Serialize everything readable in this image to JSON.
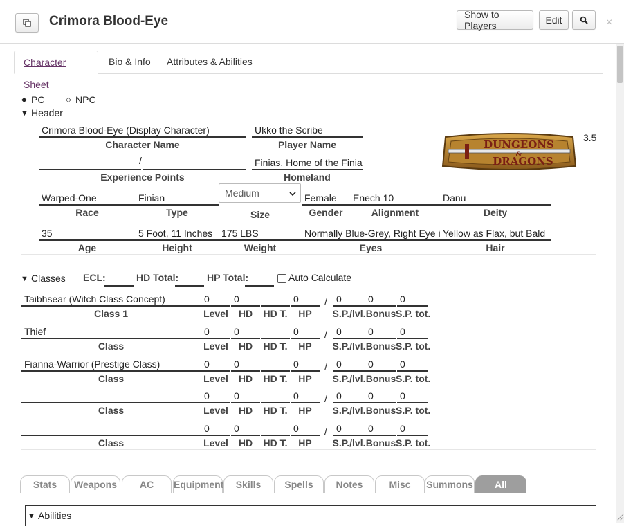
{
  "window": {
    "title": "Crimora Blood-Eye",
    "buttons": {
      "show_to_players": "Show to Players",
      "edit": "Edit"
    },
    "close_glyph": "×"
  },
  "tabs": [
    "Character Sheet",
    "Bio & Info",
    "Attributes & Abilities"
  ],
  "toggle": {
    "pc": "PC",
    "npc": "NPC"
  },
  "header": {
    "section_label": "Header",
    "character_name": "Crimora Blood-Eye    (Display Character)",
    "character_name_label": "Character Name",
    "player_name": "Ukko the Scribe",
    "player_name_label": "Player Name",
    "experience_slash": "/",
    "experience_label": "Experience Points",
    "homeland": "Finias, Home of the Finian",
    "homeland_label": "Homeland",
    "race": "Warped-One",
    "race_label": "Race",
    "type": "Finian",
    "type_label": "Type",
    "size": "Medium",
    "size_label": "Size",
    "gender": "Female",
    "gender_label": "Gender",
    "alignment": "Enech 10",
    "alignment_label": "Alignment",
    "deity": "Danu",
    "deity_label": "Deity",
    "age": "35",
    "age_label": "Age",
    "height": "5 Foot, 11 Inches",
    "height_label": "Height",
    "weight": "175 LBS",
    "weight_label": "Weight",
    "eyes": "Normally Blue-Grey, Right Eye is",
    "eyes_label": "Eyes",
    "hair": "Yellow as Flax, but Bald",
    "hair_label": "Hair",
    "version": "3.5",
    "logo_text_1": "DUNGEONS",
    "logo_ampersand": "&",
    "logo_text_2": "DRAGONS"
  },
  "classes": {
    "section_label": "Classes",
    "ecl_label": "ECL:",
    "hd_total_label": "HD Total:",
    "hp_total_label": "HP Total:",
    "auto_calc_label": "Auto Calculate",
    "col_labels": {
      "level": "Level",
      "hd": "HD",
      "hdt": "HD T.",
      "hp": "HP",
      "splvl": "S.P./lvl.",
      "bonus": "Bonus",
      "sptot": "S.P. tot."
    },
    "slash": "/",
    "rows": [
      {
        "name": "Taibhsear (Witch Class Concept)",
        "label": "Class 1",
        "level": "0",
        "hd": "0",
        "hp": "0",
        "splvl": "0",
        "bonus": "0",
        "sptot": "0"
      },
      {
        "name": "Thief",
        "label": "Class",
        "level": "0",
        "hd": "0",
        "hp": "0",
        "splvl": "0",
        "bonus": "0",
        "sptot": "0"
      },
      {
        "name": "Fianna-Warrior (Prestige Class)",
        "label": "Class",
        "level": "0",
        "hd": "0",
        "hp": "0",
        "splvl": "0",
        "bonus": "0",
        "sptot": "0"
      },
      {
        "name": "",
        "label": "Class",
        "level": "0",
        "hd": "0",
        "hp": "0",
        "splvl": "0",
        "bonus": "0",
        "sptot": "0"
      },
      {
        "name": "",
        "label": "Class",
        "level": "0",
        "hd": "0",
        "hp": "0",
        "splvl": "0",
        "bonus": "0",
        "sptot": "0"
      }
    ]
  },
  "sheet_tabs": [
    "Stats",
    "Weapons",
    "AC",
    "Equipment",
    "Skills",
    "Spells",
    "Notes",
    "Misc",
    "Summons",
    "All"
  ],
  "abilities_label": "Abilities"
}
